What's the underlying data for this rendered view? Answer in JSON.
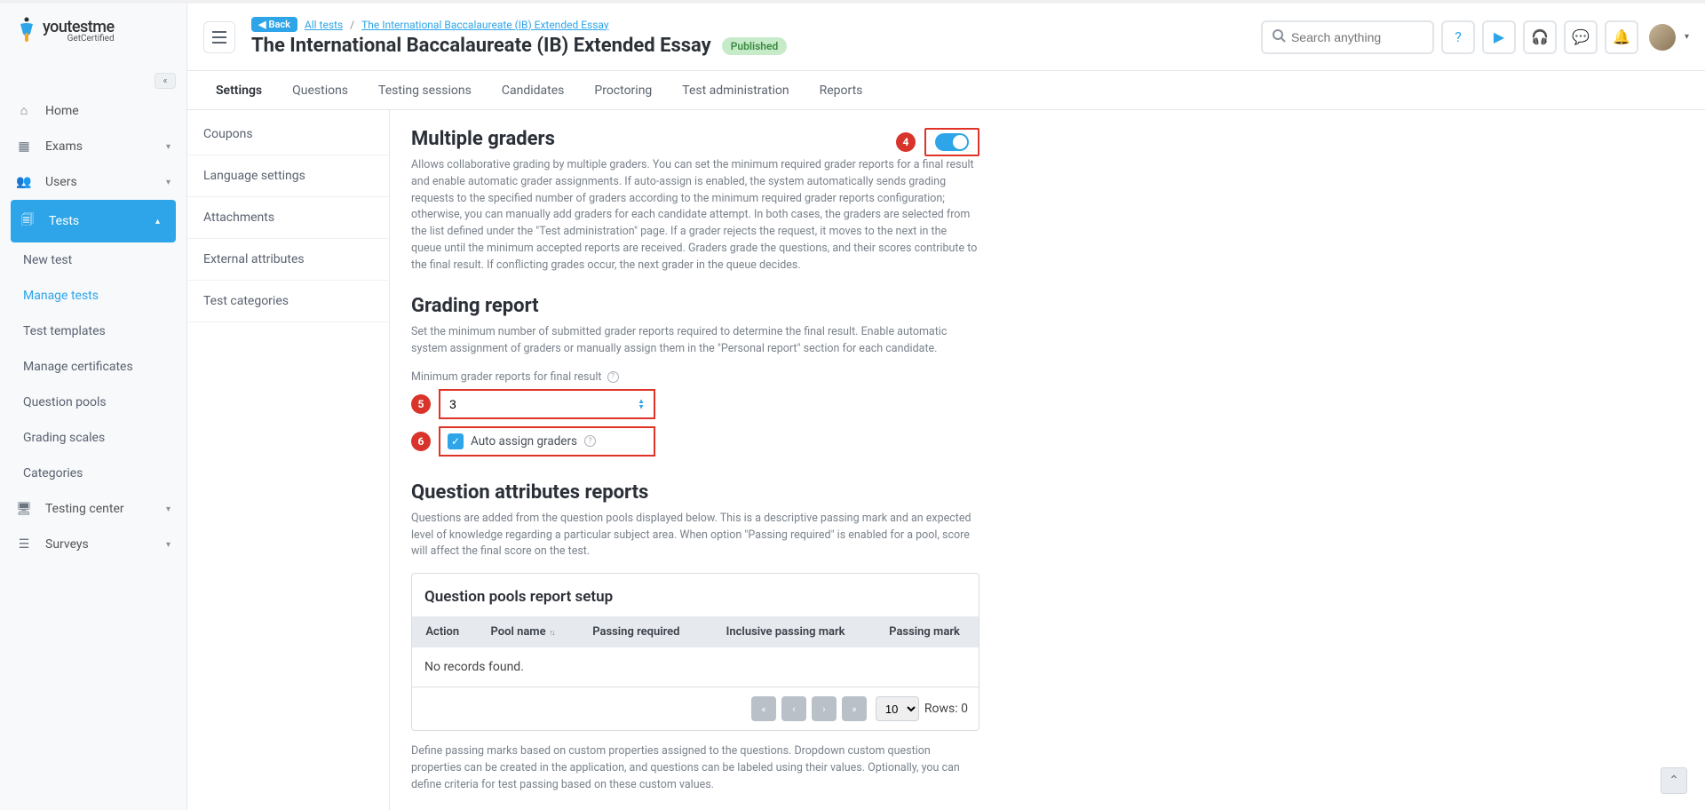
{
  "brand": {
    "name": "youtestme",
    "suffix": "GetCertified"
  },
  "breadcrumb": {
    "back": "Back",
    "all_tests": "All tests",
    "current": "The International Baccalaureate (IB) Extended Essay"
  },
  "header": {
    "title": "The International Baccalaureate (IB) Extended Essay",
    "status": "Published"
  },
  "search": {
    "placeholder": "Search anything"
  },
  "nav": {
    "home": "Home",
    "exams": "Exams",
    "users": "Users",
    "tests": "Tests",
    "testing_center": "Testing center",
    "surveys": "Surveys",
    "sub": {
      "new_test": "New test",
      "manage_tests": "Manage tests",
      "test_templates": "Test templates",
      "manage_certificates": "Manage certificates",
      "question_pools": "Question pools",
      "grading_scales": "Grading scales",
      "categories": "Categories"
    }
  },
  "tabs": [
    "Settings",
    "Questions",
    "Testing sessions",
    "Candidates",
    "Proctoring",
    "Test administration",
    "Reports"
  ],
  "sub_sidebar": [
    "Coupons",
    "Language settings",
    "Attachments",
    "External attributes",
    "Test categories"
  ],
  "sections": {
    "multiple_graders": {
      "title": "Multiple graders",
      "desc": "Allows collaborative grading by multiple graders. You can set the minimum required grader reports for a final result and enable automatic grader assignments. If auto-assign is enabled, the system automatically sends grading requests to the specified number of graders according to the minimum required grader reports configuration; otherwise, you can manually add graders for each candidate attempt. In both cases, the graders are selected from the list defined under the \"Test administration\" page. If a grader rejects the request, it moves to the next in the queue until the minimum accepted reports are received. Graders grade the questions, and their scores contribute to the final result. If conflicting grades occur, the next grader in the queue decides.",
      "badge": "4"
    },
    "grading_report": {
      "title": "Grading report",
      "desc": "Set the minimum number of submitted grader reports required to determine the final result. Enable automatic system assignment of graders or manually assign them in the \"Personal report\" section for each candidate.",
      "min_label": "Minimum grader reports for final result",
      "min_value": "3",
      "badge5": "5",
      "auto_label": "Auto assign graders",
      "badge6": "6"
    },
    "question_attrs": {
      "title": "Question attributes reports",
      "desc": "Questions are added from the question pools displayed below. This is a descriptive passing mark and an expected level of knowledge regarding a particular subject area. When option \"Passing required\" is enabled for a pool, score will affect the final score on the test.",
      "box_title": "Question pools report setup",
      "cols": [
        "Action",
        "Pool name",
        "Passing required",
        "Inclusive passing mark",
        "Passing mark"
      ],
      "no_records": "No records found.",
      "page_size": "10",
      "rows_info": "Rows: 0"
    },
    "footer_note": "Define passing marks based on custom properties assigned to the questions. Dropdown custom question properties can be created in the application, and questions can be labeled using their values. Optionally, you can define criteria for test passing based on these custom values."
  }
}
